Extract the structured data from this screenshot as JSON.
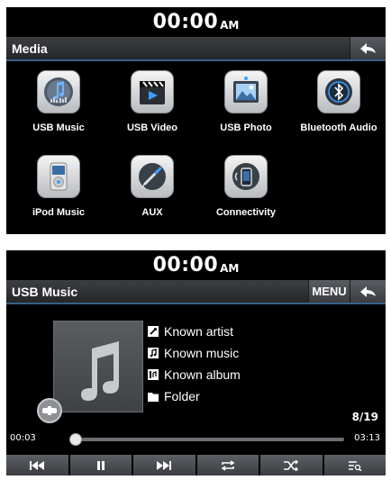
{
  "media_screen": {
    "clock": {
      "time": "00:00",
      "ampm": "AM"
    },
    "title": "Media",
    "back_icon": "back-arrow-icon",
    "tiles": [
      {
        "label": "USB Music",
        "icon": "usb-music-icon"
      },
      {
        "label": "USB Video",
        "icon": "usb-video-icon"
      },
      {
        "label": "USB Photo",
        "icon": "usb-photo-icon"
      },
      {
        "label": "Bluetooth Audio",
        "icon": "bluetooth-audio-icon"
      },
      {
        "label": "iPod Music",
        "icon": "ipod-music-icon"
      },
      {
        "label": "AUX",
        "icon": "aux-icon"
      },
      {
        "label": "Connectivity",
        "icon": "connectivity-icon"
      }
    ]
  },
  "player_screen": {
    "clock": {
      "time": "00:00",
      "ampm": "AM"
    },
    "title": "USB Music",
    "menu_label": "MENU",
    "info": {
      "artist": "Known artist",
      "music": "Known music",
      "album": "Known album",
      "folder": "Folder"
    },
    "track_count": "8/19",
    "elapsed": "00:03",
    "total": "03:13",
    "progress_fraction": 0.016,
    "controls": [
      "previous-icon",
      "pause-icon",
      "next-icon",
      "repeat-icon",
      "shuffle-icon",
      "list-search-icon"
    ]
  },
  "colors": {
    "accent": "#3b6fa8",
    "background": "#000000",
    "text": "#ffffff"
  }
}
